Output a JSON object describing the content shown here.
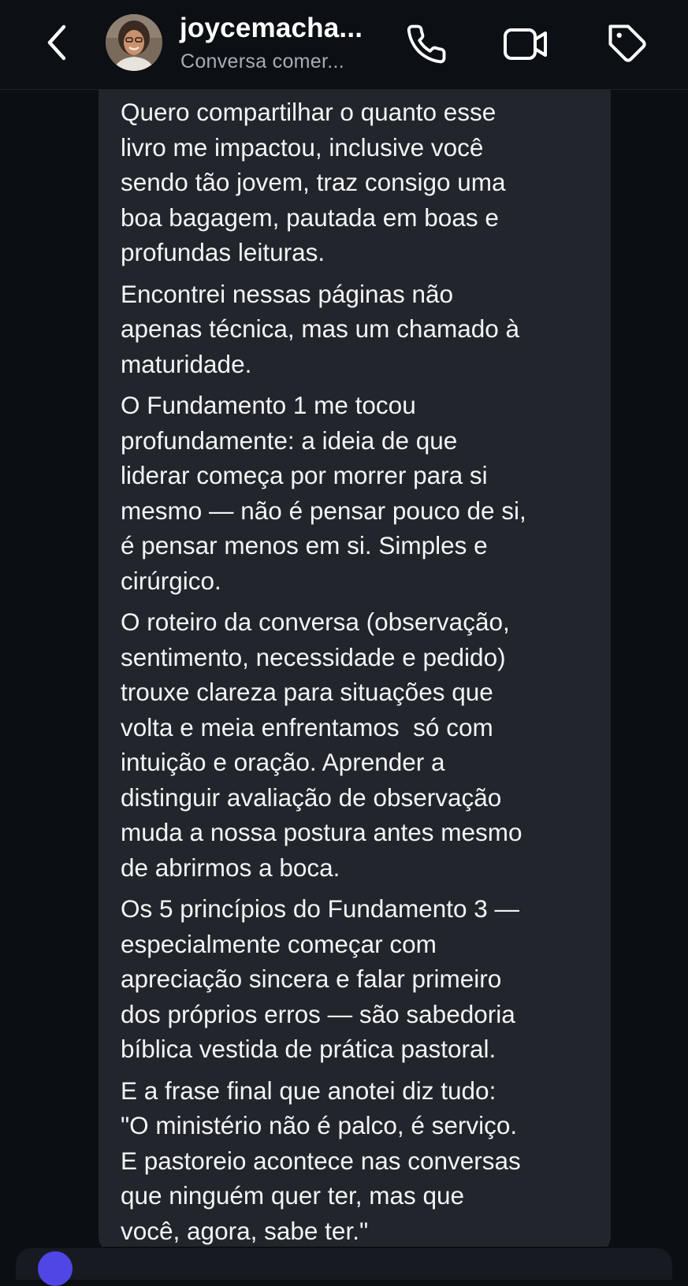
{
  "header": {
    "contact_name": "joycemacha...",
    "status": "Conversa comer..."
  },
  "message": {
    "paragraphs": [
      "Quero compartilhar o quanto esse\nlivro me impactou, inclusive você\nsendo tão jovem, traz consigo uma\nboa bagagem, pautada em boas e\nprofundas leituras.",
      "Encontrei nessas páginas não\napenas técnica, mas um chamado à\nmaturidade.",
      "O Fundamento 1 me tocou\nprofundamente: a ideia de que\nliderar começa por morrer para si\nmesmo — não é pensar pouco de si,\né pensar menos em si. Simples e\ncirúrgico.",
      "O roteiro da conversa (observação,\nsentimento, necessidade e pedido)\ntrouxe clareza para situações que\nvolta e meia enfrentamos  só com\nintuição e oração. Aprender a\ndistinguir avaliação de observação\nmuda a nossa postura antes mesmo\nde abrirmos a boca.",
      "Os 5 princípios do Fundamento 3 —\nespecialmente começar com\napreciação sincera e falar primeiro\ndos próprios erros — são sabedoria\nbíblica vestida de prática pastoral.",
      "E a frase final que anotei diz tudo:\n\"O ministério não é palco, é serviço.\nE pastoreio acontece nas conversas\nque ninguém quer ter, mas que\nvocê, agora, sabe ter.\""
    ]
  },
  "colors": {
    "background": "#0b0f14",
    "bubble": "#22262c",
    "text": "#f3f4f6",
    "status_text": "#a6adb6"
  },
  "icons": [
    "chevron-left-icon",
    "phone-icon",
    "video-camera-icon",
    "tag-icon"
  ]
}
